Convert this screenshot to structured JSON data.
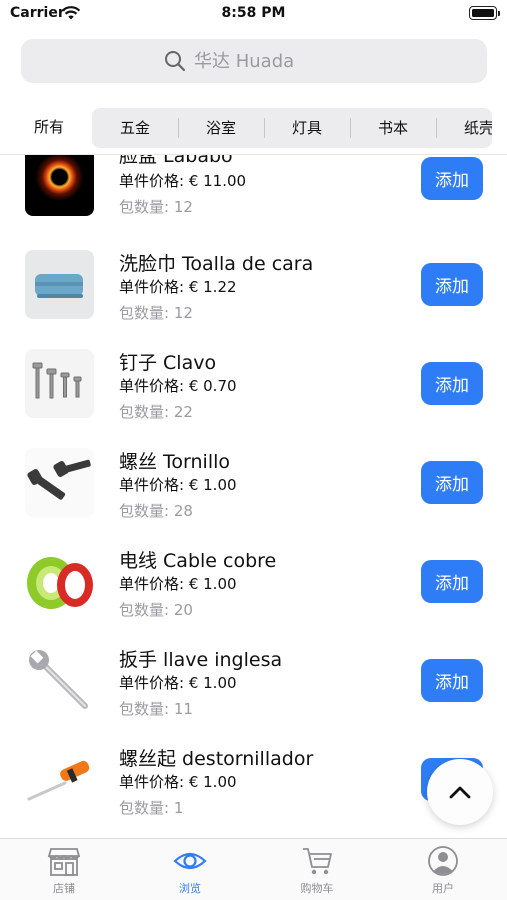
{
  "status_bar": {
    "carrier": "Carrier",
    "time": "8:58 PM"
  },
  "search": {
    "placeholder": "华达 Huada",
    "icon": "magnifier-icon"
  },
  "categories": {
    "all_label": "所有",
    "items": [
      {
        "label": "五金"
      },
      {
        "label": "浴室"
      },
      {
        "label": "灯具"
      },
      {
        "label": "书本"
      },
      {
        "label": "纸壳"
      }
    ]
  },
  "products": [
    {
      "name": "脸盆 Lababo",
      "price": "单件价格: € 11.00",
      "pack": "包数量: 12",
      "add_label": "添加",
      "image": "black-hole-image"
    },
    {
      "name": "洗脸巾 Toalla de cara",
      "price": "单件价格: € 1.22",
      "pack": "包数量: 12",
      "add_label": "添加",
      "image": "towel-image"
    },
    {
      "name": "钉子 Clavo",
      "price": "单件价格: € 0.70",
      "pack": "包数量: 22",
      "add_label": "添加",
      "image": "screws-image"
    },
    {
      "name": "螺丝 Tornillo",
      "price": "单件价格: € 1.00",
      "pack": "包数量: 28",
      "add_label": "添加",
      "image": "bolts-image"
    },
    {
      "name": "电线 Cable cobre",
      "price": "单件价格: € 1.00",
      "pack": "包数量: 20",
      "add_label": "添加",
      "image": "cable-image"
    },
    {
      "name": "扳手 llave inglesa",
      "price": "单件价格: € 1.00",
      "pack": "包数量: 11",
      "add_label": "添加",
      "image": "wrench-image"
    },
    {
      "name": "螺丝起 destornillador",
      "price": "单件价格: € 1.00",
      "pack": "包数量: 1",
      "add_label": "添加",
      "image": "screwdriver-image"
    }
  ],
  "fab": {
    "icon": "chevron-up-icon"
  },
  "tabbar": {
    "active_index": 1,
    "items": [
      {
        "label": "店铺",
        "icon": "store-icon"
      },
      {
        "label": "浏览",
        "icon": "eye-icon"
      },
      {
        "label": "购物车",
        "icon": "cart-icon"
      },
      {
        "label": "用户",
        "icon": "user-icon"
      }
    ]
  },
  "colors": {
    "accent": "#2f7df6",
    "inactive": "#8e8e93",
    "muted_text": "#9a9aa0",
    "search_bg": "#ececee"
  }
}
